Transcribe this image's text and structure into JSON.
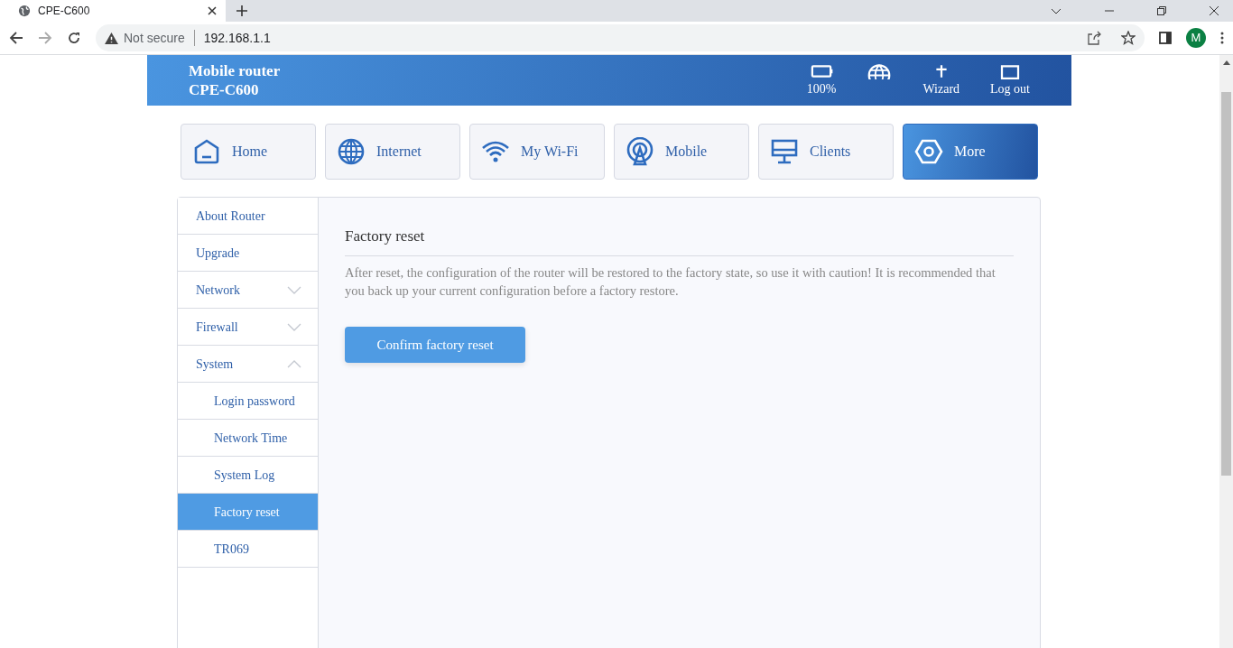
{
  "browser": {
    "tab_title": "CPE-C600",
    "security": "Not secure",
    "url": "192.168.1.1",
    "profile_initial": "M"
  },
  "header": {
    "brand_line1": "Mobile router",
    "brand_line2": "CPE-C600",
    "actions": [
      {
        "kind": "battery",
        "label": "100%"
      },
      {
        "kind": "globe"
      },
      {
        "kind": "wizard",
        "label": "Wizard"
      },
      {
        "kind": "logout",
        "label": "Log out"
      }
    ]
  },
  "nav_tiles": [
    {
      "kind": "home",
      "label": "Home",
      "selected": false
    },
    {
      "kind": "internet",
      "label": "Internet",
      "selected": false
    },
    {
      "kind": "wifi",
      "label": "My Wi-Fi",
      "selected": false
    },
    {
      "kind": "mobile",
      "label": "Mobile",
      "selected": false
    },
    {
      "kind": "clients",
      "label": "Clients",
      "selected": false
    },
    {
      "kind": "more",
      "label": "More",
      "selected": true
    }
  ],
  "sidebar": {
    "items": [
      {
        "label": "About Router",
        "selected": false
      },
      {
        "label": "Upgrade",
        "selected": false
      },
      {
        "label": "Network",
        "selected": false,
        "expanded": false
      },
      {
        "label": "Firewall",
        "selected": false,
        "expanded": false
      },
      {
        "label": "System",
        "selected": false,
        "expanded": true,
        "children": [
          {
            "label": "Login password",
            "selected": false
          },
          {
            "label": "Network Time",
            "selected": false
          },
          {
            "label": "System Log",
            "selected": false
          },
          {
            "label": "Factory reset",
            "selected": true
          },
          {
            "label": "TR069",
            "selected": false
          }
        ]
      }
    ]
  },
  "content": {
    "title": "Factory reset",
    "description": "After reset, the configuration of the router will be restored to the factory state, so use it with caution! It is recommended that you back up your current configuration before a factory restore.",
    "button": "Confirm factory reset"
  }
}
